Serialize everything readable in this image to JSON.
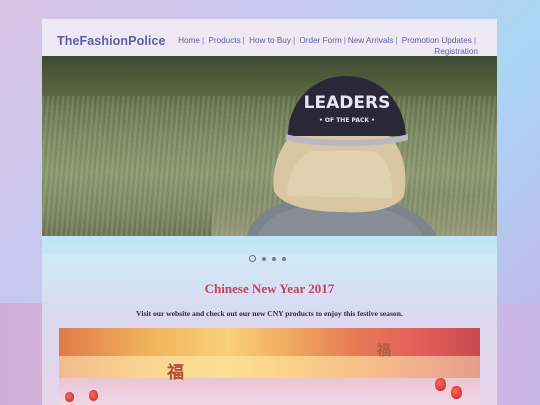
{
  "site": {
    "brand": "TheFashionPolice"
  },
  "nav": {
    "items": [
      {
        "label": "Home"
      },
      {
        "label": "Products"
      },
      {
        "label": "How to Buy"
      },
      {
        "label": "Order Form"
      },
      {
        "label": "New Arrivals"
      },
      {
        "label": "Promotion Updates"
      },
      {
        "label": "Registration"
      }
    ],
    "separator": "|"
  },
  "hero": {
    "cap_text_top": "LEADERS",
    "cap_text_bottom": "• OF THE PACK •"
  },
  "slider": {
    "slide_count": 4,
    "active_index": 0
  },
  "promo": {
    "title": "Chinese New Year 2017",
    "text": "Visit our website and check out our new CNY products to enjoy this festive season."
  },
  "banner": {
    "glyph_main": "福",
    "glyph_secondary": "福"
  },
  "colors": {
    "brand": "#5b5fa8",
    "promo_title": "#c2415e",
    "slider_bg": "#bfe6f6"
  }
}
